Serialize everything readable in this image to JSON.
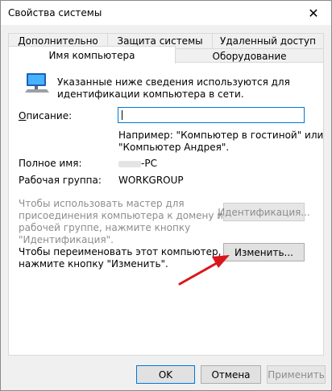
{
  "window": {
    "title": "Свойства системы",
    "close_glyph": "✕"
  },
  "tabs": {
    "row1": [
      {
        "label": "Дополнительно"
      },
      {
        "label": "Защита системы"
      },
      {
        "label": "Удаленный доступ"
      }
    ],
    "row2": [
      {
        "label": "Имя компьютера"
      },
      {
        "label": "Оборудование"
      }
    ],
    "active": "Имя компьютера"
  },
  "computer_name_tab": {
    "intro": [
      "Указанные ниже сведения используются для",
      "идентификации компьютера в сети."
    ],
    "description_label": "Описание:",
    "description_value": "",
    "example": [
      "Например: \"Компьютер в гостиной\" или",
      "\"Компьютер Андрея\"."
    ],
    "full_name_label": "Полное имя:",
    "full_name_value": "-PC",
    "workgroup_label": "Рабочая группа:",
    "workgroup_value": "WORKGROUP",
    "wizard_text": [
      "Чтобы использовать мастер для",
      "присоединения компьютера к домену или",
      "рабочей группе, нажмите кнопку",
      "\"Идентификация\"."
    ],
    "identify_button": "Идентификация...",
    "rename_text": [
      "Чтобы переименовать этот компьютер,",
      "нажмите кнопку \"Изменить\"."
    ],
    "change_button": "Изменить..."
  },
  "footer": {
    "ok": "OK",
    "cancel": "Отмена",
    "apply": "Применить"
  },
  "colors": {
    "accent": "#0078d7",
    "arrow": "#d9161c",
    "disabled_text": "#8d8d8d"
  },
  "icons": {
    "computer": "computer-monitor-icon"
  }
}
